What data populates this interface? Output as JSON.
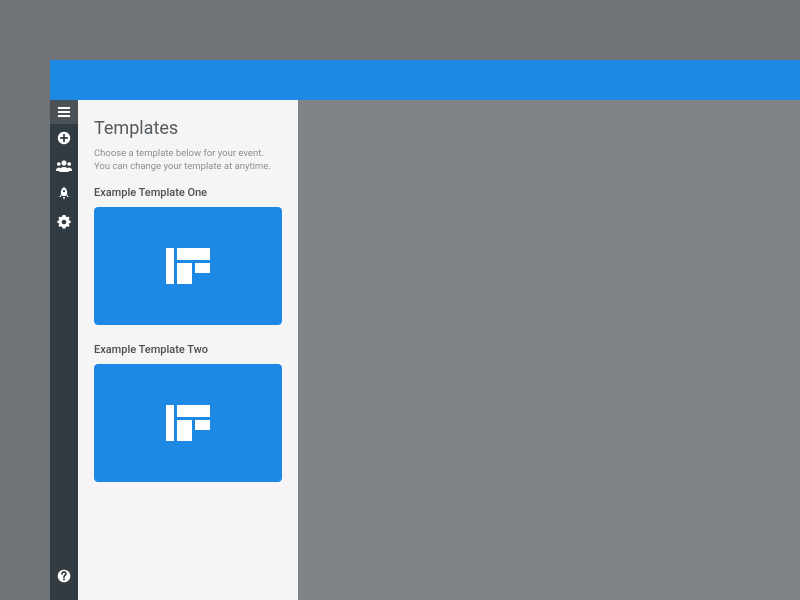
{
  "colors": {
    "accent": "#1e88e5",
    "sidebar_bg": "#333b42",
    "panel_bg": "#f5f5f5",
    "page_bg": "#6f7376",
    "content_bg": "#808487"
  },
  "sidebar": {
    "top_icons": [
      "menu-icon",
      "add-icon",
      "people-icon",
      "rocket-icon",
      "gear-icon"
    ],
    "bottom_icons": [
      "help-icon"
    ]
  },
  "templates_panel": {
    "title": "Templates",
    "description": "Choose a template below for your event. You can change your template at anytime.",
    "items": [
      {
        "name": "Example Template One"
      },
      {
        "name": "Example Template Two"
      }
    ]
  }
}
